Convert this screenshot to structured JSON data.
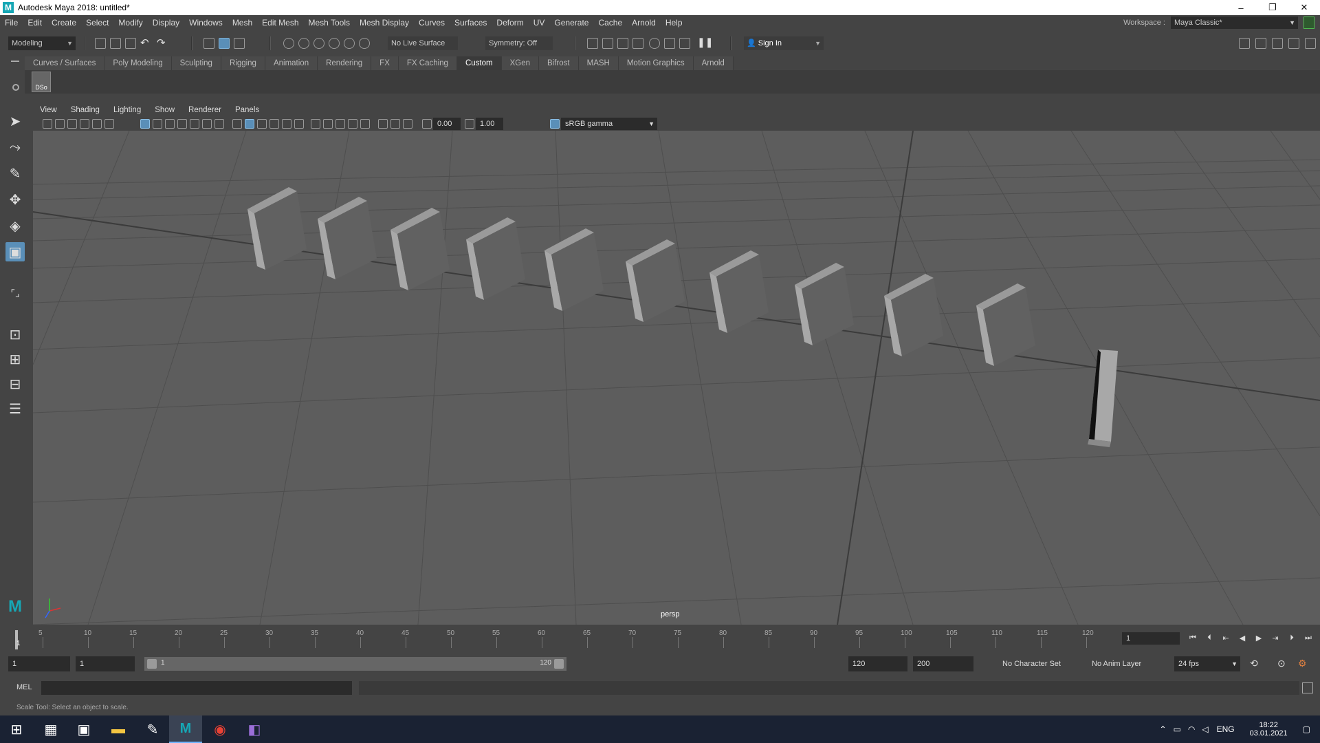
{
  "window": {
    "title": "Autodesk Maya 2018: untitled*",
    "app_icon": "M",
    "controls": [
      "–",
      "❐",
      "✕"
    ]
  },
  "menubar": {
    "items": [
      "File",
      "Edit",
      "Create",
      "Select",
      "Modify",
      "Display",
      "Windows",
      "Mesh",
      "Edit Mesh",
      "Mesh Tools",
      "Mesh Display",
      "Curves",
      "Surfaces",
      "Deform",
      "UV",
      "Generate",
      "Cache",
      "Arnold",
      "Help"
    ],
    "workspace_label": "Workspace :",
    "workspace_value": "Maya Classic*"
  },
  "statusline": {
    "menuset": "Modeling",
    "live_surface": "No Live Surface",
    "symmetry": "Symmetry: Off",
    "sign_in": "Sign In"
  },
  "shelf": {
    "tabs": [
      "Curves / Surfaces",
      "Poly Modeling",
      "Sculpting",
      "Rigging",
      "Animation",
      "Rendering",
      "FX",
      "FX Caching",
      "Custom",
      "XGen",
      "Bifrost",
      "MASH",
      "Motion Graphics",
      "Arnold"
    ],
    "active_tab": "Custom",
    "button_label": "DSo"
  },
  "panel": {
    "menus": [
      "View",
      "Shading",
      "Lighting",
      "Show",
      "Renderer",
      "Panels"
    ],
    "exposure": "0.00",
    "gamma": "1.00",
    "color_space": "sRGB gamma",
    "camera": "persp"
  },
  "timeslider": {
    "ticks": [
      "5",
      "10",
      "15",
      "20",
      "25",
      "30",
      "35",
      "40",
      "45",
      "50",
      "55",
      "60",
      "65",
      "70",
      "75",
      "80",
      "85",
      "90",
      "95",
      "100",
      "105",
      "110",
      "115",
      "120"
    ],
    "current_marker": "1",
    "current_frame": "1"
  },
  "range": {
    "start_time": "1",
    "playback_start": "1",
    "slider_start": "1",
    "slider_end": "120",
    "playback_end": "120",
    "end_time": "200",
    "character_set": "No Character Set",
    "anim_layer": "No Anim Layer",
    "fps": "24 fps"
  },
  "cmdline": {
    "label": "MEL"
  },
  "helpline": {
    "text": "Scale Tool: Select an object to scale."
  },
  "taskbar": {
    "lang": "ENG",
    "time": "18:22",
    "date": "03.01.2021"
  },
  "colors": {
    "accent": "#5a8fb8",
    "viewport_bg": "#5d5d5d",
    "maya_teal": "#16a7b5"
  }
}
